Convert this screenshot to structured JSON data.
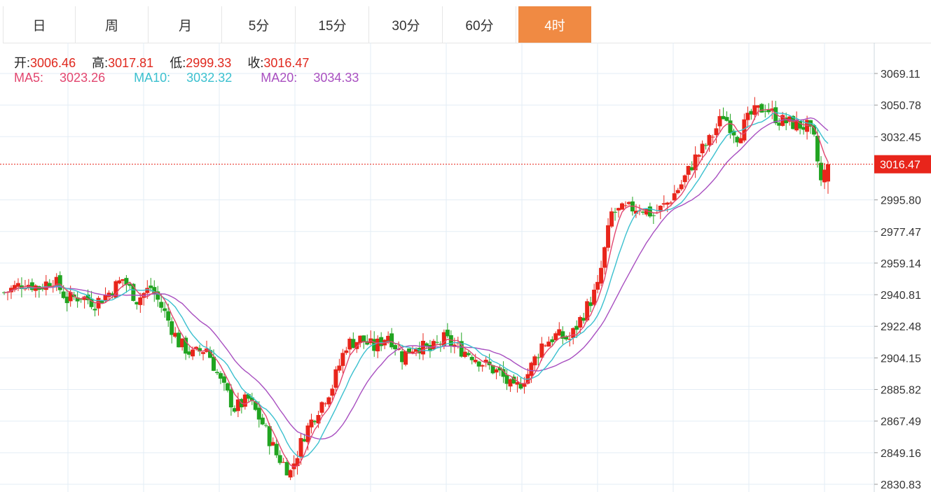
{
  "tabs": [
    {
      "label": "日",
      "active": false
    },
    {
      "label": "周",
      "active": false
    },
    {
      "label": "月",
      "active": false
    },
    {
      "label": "5分",
      "active": false
    },
    {
      "label": "15分",
      "active": false
    },
    {
      "label": "30分",
      "active": false
    },
    {
      "label": "60分",
      "active": false
    },
    {
      "label": "4时",
      "active": true
    }
  ],
  "ohlc": {
    "open_label": "开:",
    "open": "3006.46",
    "high_label": "高:",
    "high": "3017.81",
    "low_label": "低:",
    "low": "2999.33",
    "close_label": "收:",
    "close": "3016.47"
  },
  "ma": {
    "ma5_label": "MA5:",
    "ma5": "3023.26",
    "ma10_label": "MA10:",
    "ma10": "3032.32",
    "ma20_label": "MA20:",
    "ma20": "3034.33"
  },
  "colors": {
    "up": "#e8251b",
    "down": "#21a421",
    "ma5": "#e2466f",
    "ma10": "#3bc0cf",
    "ma20": "#a84fc0",
    "grid": "#e3edf5",
    "last_price": "#e8251b",
    "active_tab": "#f08a43"
  },
  "chart_data": {
    "type": "candlestick",
    "y_ticks": [
      3069.11,
      3050.78,
      3032.45,
      3016.47,
      2995.8,
      2977.47,
      2959.14,
      2940.81,
      2922.48,
      2904.15,
      2885.82,
      2867.49,
      2849.16,
      2830.83
    ],
    "y_tick_labels": [
      "3069.11",
      "3050.78",
      "3032.45",
      "3016.47",
      "2995.80",
      "2977.47",
      "2959.14",
      "2940.81",
      "2922.48",
      "2904.15",
      "2885.82",
      "2867.49",
      "2849.16",
      "2830.83"
    ],
    "last_price": 3016.47,
    "last_price_label": "3016.47",
    "close_path": [
      [
        0,
        2942
      ],
      [
        6,
        2948
      ],
      [
        10,
        2945
      ],
      [
        14,
        2950
      ],
      [
        18,
        2938
      ],
      [
        22,
        2940
      ],
      [
        26,
        2936
      ],
      [
        30,
        2942
      ],
      [
        34,
        2950
      ],
      [
        38,
        2938
      ],
      [
        42,
        2945
      ],
      [
        46,
        2930
      ],
      [
        50,
        2913
      ],
      [
        54,
        2906
      ],
      [
        58,
        2910
      ],
      [
        62,
        2890
      ],
      [
        66,
        2875
      ],
      [
        70,
        2880
      ],
      [
        74,
        2866
      ],
      [
        78,
        2848
      ],
      [
        82,
        2838
      ],
      [
        86,
        2860
      ],
      [
        90,
        2875
      ],
      [
        94,
        2888
      ],
      [
        98,
        2912
      ],
      [
        102,
        2915
      ],
      [
        106,
        2910
      ],
      [
        110,
        2918
      ],
      [
        114,
        2905
      ],
      [
        118,
        2912
      ],
      [
        122,
        2908
      ],
      [
        126,
        2915
      ],
      [
        130,
        2910
      ],
      [
        134,
        2906
      ],
      [
        138,
        2900
      ],
      [
        142,
        2895
      ],
      [
        146,
        2885
      ],
      [
        150,
        2895
      ],
      [
        154,
        2912
      ],
      [
        158,
        2917
      ],
      [
        162,
        2915
      ],
      [
        166,
        2930
      ],
      [
        170,
        2945
      ],
      [
        174,
        2988
      ],
      [
        178,
        2990
      ],
      [
        182,
        2992
      ],
      [
        186,
        2987
      ],
      [
        190,
        2994
      ],
      [
        194,
        3005
      ],
      [
        198,
        3020
      ],
      [
        202,
        3030
      ],
      [
        206,
        3045
      ],
      [
        210,
        3033
      ],
      [
        214,
        3045
      ],
      [
        218,
        3050
      ],
      [
        222,
        3042
      ],
      [
        226,
        3040
      ],
      [
        230,
        3038
      ],
      [
        232,
        3030
      ],
      [
        234,
        3006
      ],
      [
        236,
        3016.47
      ]
    ],
    "ma5": [
      3023.26
    ],
    "ma10": [
      3032.32
    ],
    "ma20": [
      3034.33
    ]
  }
}
